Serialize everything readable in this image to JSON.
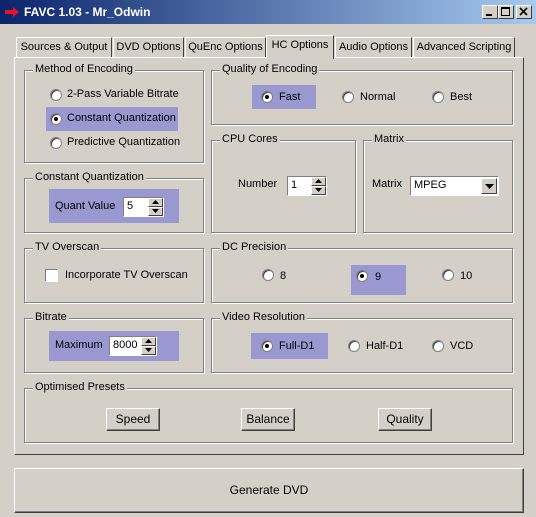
{
  "window": {
    "title": "FAVC 1.03 - Mr_Odwin"
  },
  "tabs": [
    {
      "label": "Sources & Output"
    },
    {
      "label": "DVD Options"
    },
    {
      "label": "QuEnc Options"
    },
    {
      "label": "HC Options"
    },
    {
      "label": "Audio Options"
    },
    {
      "label": "Advanced Scripting"
    }
  ],
  "encoding_method": {
    "title": "Method of Encoding",
    "options": [
      "2-Pass Variable Bitrate",
      "Constant Quantization",
      "Predictive Quantization"
    ],
    "selected": "Constant Quantization"
  },
  "quality": {
    "title": "Quality of Encoding",
    "options": [
      "Fast",
      "Normal",
      "Best"
    ],
    "selected": "Fast"
  },
  "cpu": {
    "title": "CPU Cores",
    "label": "Number",
    "value": "1"
  },
  "matrix": {
    "title": "Matrix",
    "label": "Matrix",
    "value": "MPEG"
  },
  "constant_quant": {
    "title": "Constant Quantization",
    "label": "Quant Value",
    "value": "5"
  },
  "tv_overscan": {
    "title": "TV Overscan",
    "label": "Incorporate TV Overscan",
    "checked": false
  },
  "dc_precision": {
    "title": "DC Precision",
    "options": [
      "8",
      "9",
      "10"
    ],
    "selected": "9"
  },
  "bitrate": {
    "title": "Bitrate",
    "label": "Maximum",
    "value": "8000"
  },
  "video_resolution": {
    "title": "Video Resolution",
    "options": [
      "Full-D1",
      "Half-D1",
      "VCD"
    ],
    "selected": "Full-D1"
  },
  "presets": {
    "title": "Optimised Presets",
    "buttons": [
      "Speed",
      "Balance",
      "Quality"
    ]
  },
  "generate": {
    "label": "Generate DVD"
  },
  "colors": {
    "titlebar_start": "#0a246a",
    "titlebar_end": "#a6caf0",
    "highlight": "#9a98d0",
    "face": "#d4d0c8"
  },
  "icons": [
    "app-arrow-icon",
    "minimize-icon",
    "maximize-icon",
    "close-icon",
    "spin-up-icon",
    "spin-down-icon",
    "chevron-down-icon"
  ]
}
